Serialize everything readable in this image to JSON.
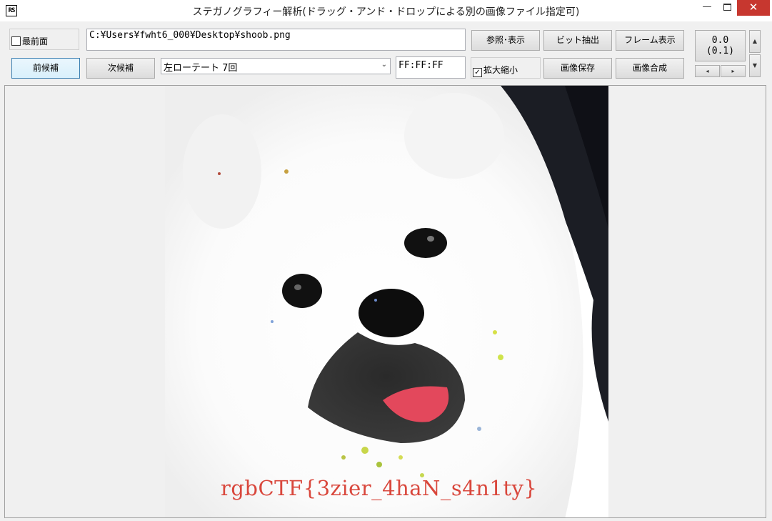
{
  "window": {
    "icon_text": "RS",
    "title": "ステガノグラフィー解析(ドラッグ・アンド・ドロップによる別の画像ファイル指定可)",
    "minimize": "—",
    "close": "✕"
  },
  "toolbar": {
    "topmost_label": "最前面",
    "topmost_checked": false,
    "file_path": "C:¥Users¥fwht6_000¥Desktop¥shoob.png",
    "browse_label": "参照･表示",
    "bit_extract_label": "ビット抽出",
    "frame_label": "フレーム表示",
    "prev_label": "前候補",
    "next_label": "次候補",
    "mode_selected": "左ローテート 7回",
    "color_value": "FF:FF:FF",
    "zoom_label": "拡大縮小",
    "zoom_checked": true,
    "save_label": "画像保存",
    "compose_label": "画像合成"
  },
  "counter": {
    "line1": "0.0",
    "line2": "(0.1)"
  },
  "image": {
    "flag_text": "rgbCTF{3zier_4haN_s4n1ty}"
  },
  "colors": {
    "close_button": "#c7372f",
    "primary_border": "#3c7fb1",
    "flag_text": "#d9473c"
  }
}
